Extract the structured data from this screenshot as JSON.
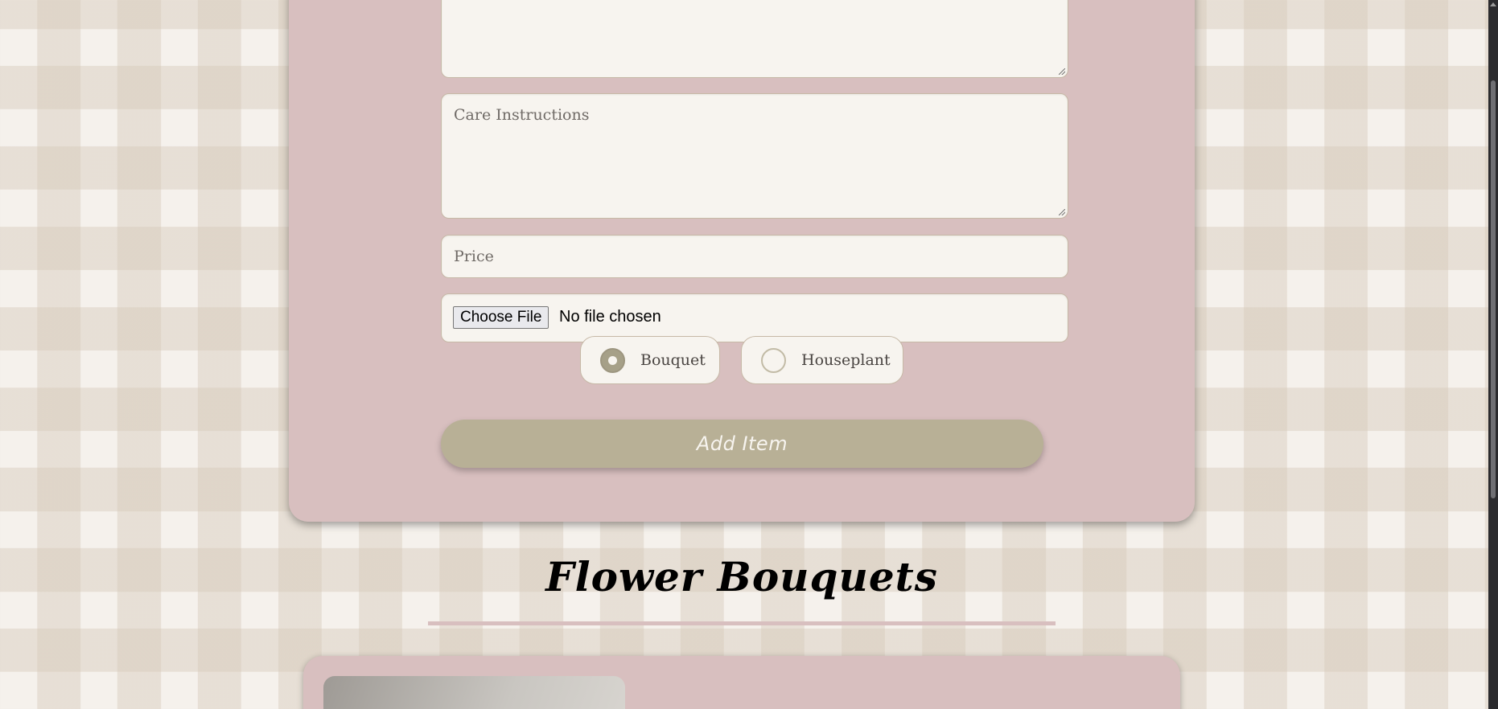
{
  "form": {
    "care_placeholder": "Care Instructions",
    "price_placeholder": "Price",
    "file_button_label": "Choose File",
    "file_status": "No file chosen",
    "radio_options": [
      {
        "label": "Bouquet",
        "checked": true
      },
      {
        "label": "Houseplant",
        "checked": false
      }
    ],
    "submit_label": "Add Item"
  },
  "section": {
    "title": "Flower Bouquets"
  },
  "colors": {
    "card_background": "#d8bfbf",
    "input_background": "#f7f4ef",
    "accent": "#b8b096"
  }
}
